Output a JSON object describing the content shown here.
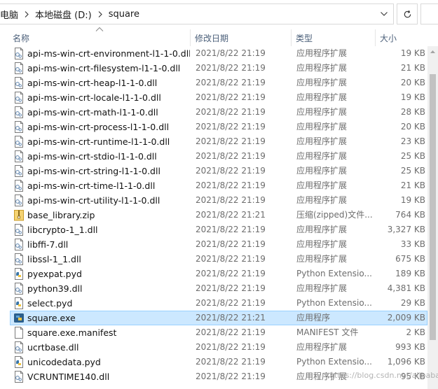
{
  "breadcrumb": {
    "items": [
      "电脑",
      "本地磁盘 (D:)",
      "square"
    ]
  },
  "columns": {
    "name": "名称",
    "date": "修改日期",
    "type": "类型",
    "size": "大小"
  },
  "colors": {
    "selection_bg": "#cce8ff",
    "selection_border": "#99d1ff",
    "header_text": "#4c607a",
    "muted_text": "#6d6d6d"
  },
  "files": [
    {
      "name": "api-ms-win-crt-environment-l1-1-0.dll",
      "date": "2021/8/22 21:19",
      "type": "应用程序扩展",
      "size": "19 KB",
      "icon": "dll-icon"
    },
    {
      "name": "api-ms-win-crt-filesystem-l1-1-0.dll",
      "date": "2021/8/22 21:19",
      "type": "应用程序扩展",
      "size": "21 KB",
      "icon": "dll-icon"
    },
    {
      "name": "api-ms-win-crt-heap-l1-1-0.dll",
      "date": "2021/8/22 21:19",
      "type": "应用程序扩展",
      "size": "20 KB",
      "icon": "dll-icon"
    },
    {
      "name": "api-ms-win-crt-locale-l1-1-0.dll",
      "date": "2021/8/22 21:19",
      "type": "应用程序扩展",
      "size": "19 KB",
      "icon": "dll-icon"
    },
    {
      "name": "api-ms-win-crt-math-l1-1-0.dll",
      "date": "2021/8/22 21:19",
      "type": "应用程序扩展",
      "size": "28 KB",
      "icon": "dll-icon"
    },
    {
      "name": "api-ms-win-crt-process-l1-1-0.dll",
      "date": "2021/8/22 21:19",
      "type": "应用程序扩展",
      "size": "20 KB",
      "icon": "dll-icon"
    },
    {
      "name": "api-ms-win-crt-runtime-l1-1-0.dll",
      "date": "2021/8/22 21:19",
      "type": "应用程序扩展",
      "size": "23 KB",
      "icon": "dll-icon"
    },
    {
      "name": "api-ms-win-crt-stdio-l1-1-0.dll",
      "date": "2021/8/22 21:19",
      "type": "应用程序扩展",
      "size": "25 KB",
      "icon": "dll-icon"
    },
    {
      "name": "api-ms-win-crt-string-l1-1-0.dll",
      "date": "2021/8/22 21:19",
      "type": "应用程序扩展",
      "size": "25 KB",
      "icon": "dll-icon"
    },
    {
      "name": "api-ms-win-crt-time-l1-1-0.dll",
      "date": "2021/8/22 21:19",
      "type": "应用程序扩展",
      "size": "21 KB",
      "icon": "dll-icon"
    },
    {
      "name": "api-ms-win-crt-utility-l1-1-0.dll",
      "date": "2021/8/22 21:19",
      "type": "应用程序扩展",
      "size": "19 KB",
      "icon": "dll-icon"
    },
    {
      "name": "base_library.zip",
      "date": "2021/8/22 21:21",
      "type": "压缩(zipped)文件...",
      "size": "764 KB",
      "icon": "zip-icon"
    },
    {
      "name": "libcrypto-1_1.dll",
      "date": "2021/8/22 21:19",
      "type": "应用程序扩展",
      "size": "3,327 KB",
      "icon": "dll-icon"
    },
    {
      "name": "libffi-7.dll",
      "date": "2021/8/22 21:19",
      "type": "应用程序扩展",
      "size": "33 KB",
      "icon": "dll-icon"
    },
    {
      "name": "libssl-1_1.dll",
      "date": "2021/8/22 21:19",
      "type": "应用程序扩展",
      "size": "675 KB",
      "icon": "dll-icon"
    },
    {
      "name": "pyexpat.pyd",
      "date": "2021/8/22 21:19",
      "type": "Python Extensio...",
      "size": "189 KB",
      "icon": "pyd-icon"
    },
    {
      "name": "python39.dll",
      "date": "2021/8/22 21:19",
      "type": "应用程序扩展",
      "size": "4,381 KB",
      "icon": "dll-icon"
    },
    {
      "name": "select.pyd",
      "date": "2021/8/22 21:19",
      "type": "Python Extensio...",
      "size": "29 KB",
      "icon": "pyd-icon"
    },
    {
      "name": "square.exe",
      "date": "2021/8/22 21:21",
      "type": "应用程序",
      "size": "2,009 KB",
      "icon": "exe-icon",
      "selected": true
    },
    {
      "name": "square.exe.manifest",
      "date": "2021/8/22 21:19",
      "type": "MANIFEST 文件",
      "size": "2 KB",
      "icon": "blank-file-icon"
    },
    {
      "name": "ucrtbase.dll",
      "date": "2021/8/22 21:19",
      "type": "应用程序扩展",
      "size": "993 KB",
      "icon": "dll-icon"
    },
    {
      "name": "unicodedata.pyd",
      "date": "2021/8/22 21:19",
      "type": "Python Extensio...",
      "size": "1,096 KB",
      "icon": "pyd-icon"
    },
    {
      "name": "VCRUNTIME140.dll",
      "date": "2021/8/22 21:19",
      "type": "应用程序扩展",
      "size": "95 KB",
      "icon": "dll-icon"
    }
  ],
  "watermark": "https://blog.csdn.net/alibaba"
}
